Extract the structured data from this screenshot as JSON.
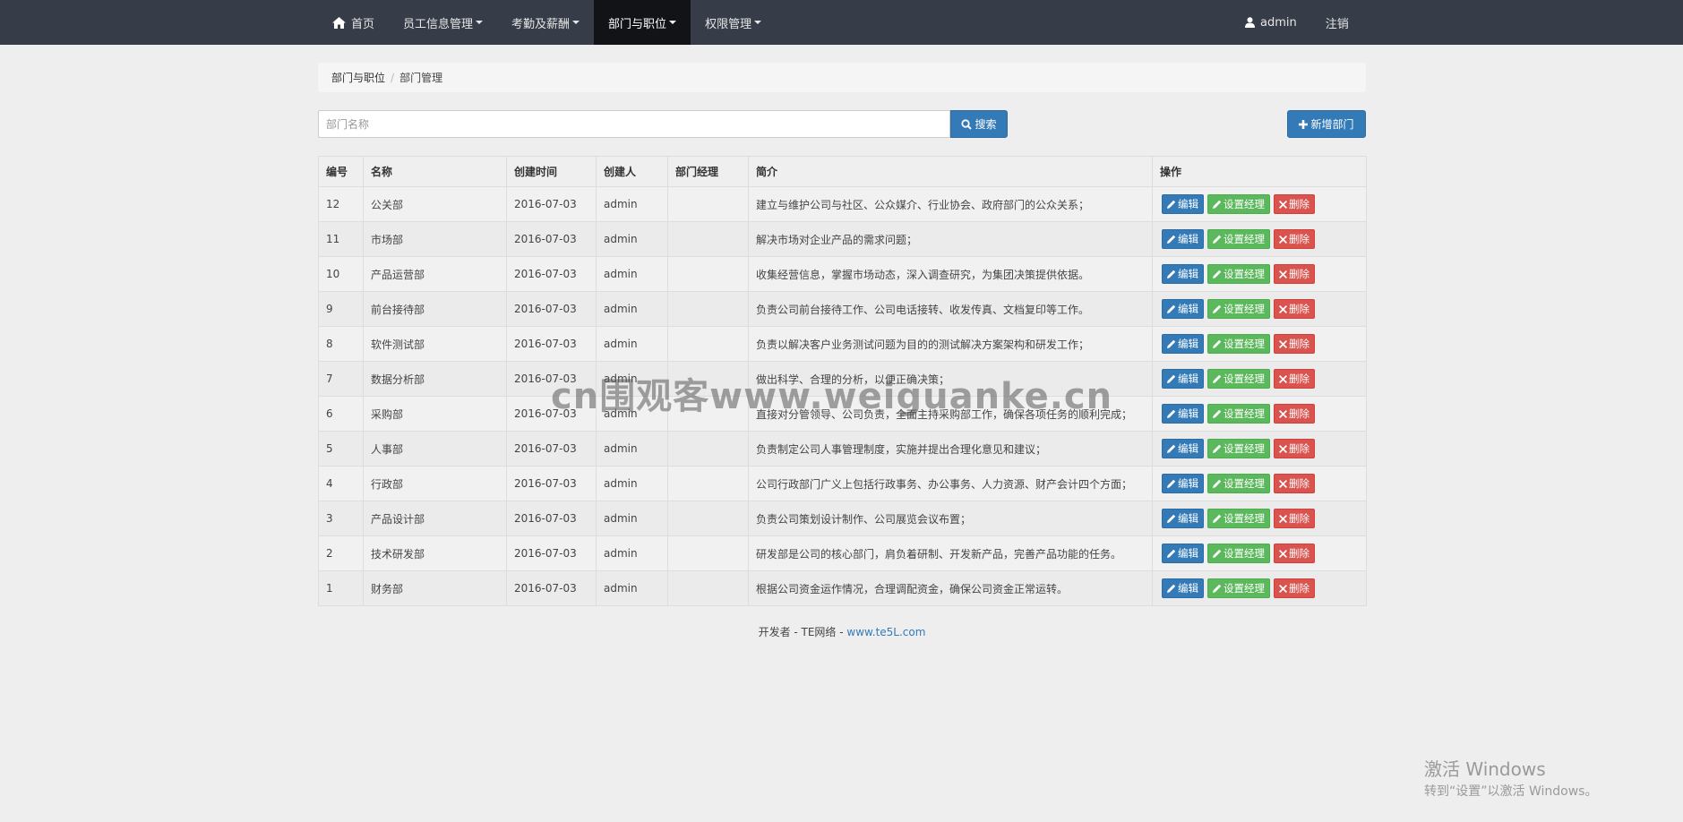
{
  "navbar": {
    "home": "首页",
    "items": [
      {
        "label": "员工信息管理",
        "active": false
      },
      {
        "label": "考勤及薪酬",
        "active": false
      },
      {
        "label": "部门与职位",
        "active": true
      },
      {
        "label": "权限管理",
        "active": false
      }
    ],
    "user": "admin",
    "logout": "注销"
  },
  "breadcrumb": {
    "parent": "部门与职位",
    "separator": "/",
    "current": "部门管理"
  },
  "search": {
    "placeholder": "部门名称",
    "value": "",
    "button_label": "搜索"
  },
  "add_button_label": "新增部门",
  "table": {
    "columns": [
      "编号",
      "名称",
      "创建时间",
      "创建人",
      "部门经理",
      "简介",
      "操作"
    ],
    "actions": {
      "edit": "编辑",
      "set_manager": "设置经理",
      "delete": "删除"
    },
    "rows": [
      {
        "id": "12",
        "name": "公关部",
        "created": "2016-07-03",
        "creator": "admin",
        "manager": "",
        "intro": "建立与维护公司与社区、公众媒介、行业协会、政府部门的公众关系；"
      },
      {
        "id": "11",
        "name": "市场部",
        "created": "2016-07-03",
        "creator": "admin",
        "manager": "",
        "intro": "解决市场对企业产品的需求问题；"
      },
      {
        "id": "10",
        "name": "产品运营部",
        "created": "2016-07-03",
        "creator": "admin",
        "manager": "",
        "intro": "收集经营信息，掌握市场动态，深入调查研究，为集团决策提供依据。"
      },
      {
        "id": "9",
        "name": "前台接待部",
        "created": "2016-07-03",
        "creator": "admin",
        "manager": "",
        "intro": "负责公司前台接待工作、公司电话接转、收发传真、文档复印等工作。"
      },
      {
        "id": "8",
        "name": "软件测试部",
        "created": "2016-07-03",
        "creator": "admin",
        "manager": "",
        "intro": "负责以解决客户业务测试问题为目的的测试解决方案架构和研发工作；"
      },
      {
        "id": "7",
        "name": "数据分析部",
        "created": "2016-07-03",
        "creator": "admin",
        "manager": "",
        "intro": "做出科学、合理的分析，以便正确决策；"
      },
      {
        "id": "6",
        "name": "采购部",
        "created": "2016-07-03",
        "creator": "admin",
        "manager": "",
        "intro": "直接对分管领导、公司负责，全面主持采购部工作，确保各项任务的顺利完成；"
      },
      {
        "id": "5",
        "name": "人事部",
        "created": "2016-07-03",
        "creator": "admin",
        "manager": "",
        "intro": "负责制定公司人事管理制度，实施并提出合理化意见和建议；"
      },
      {
        "id": "4",
        "name": "行政部",
        "created": "2016-07-03",
        "creator": "admin",
        "manager": "",
        "intro": "公司行政部门广义上包括行政事务、办公事务、人力资源、财产会计四个方面；"
      },
      {
        "id": "3",
        "name": "产品设计部",
        "created": "2016-07-03",
        "creator": "admin",
        "manager": "",
        "intro": "负责公司策划设计制作、公司展览会议布置；"
      },
      {
        "id": "2",
        "name": "技术研发部",
        "created": "2016-07-03",
        "creator": "admin",
        "manager": "",
        "intro": "研发部是公司的核心部门，肩负着研制、开发新产品，完善产品功能的任务。"
      },
      {
        "id": "1",
        "name": "财务部",
        "created": "2016-07-03",
        "creator": "admin",
        "manager": "",
        "intro": "根据公司资金运作情况，合理调配资金，确保公司资金正常运转。"
      }
    ]
  },
  "footer": {
    "prefix": "开发者 - TE网络 - ",
    "link": "www.te5L.com"
  },
  "watermark": "cn围观客www.weiguanke.cn",
  "windows_activation": {
    "title": "激活 Windows",
    "subtitle": "转到“设置”以激活 Windows。"
  },
  "colors": {
    "navbar": "#373c49",
    "navbar_active": "#111317",
    "primary": "#337ab7",
    "success": "#5cb85c",
    "danger": "#d9534f",
    "page_bg": "#eeeeee"
  },
  "icons": {
    "home": "home-icon",
    "user": "user-icon",
    "search": "search-icon",
    "add": "plus-icon",
    "edit": "pencil-icon",
    "delete": "times-icon"
  }
}
